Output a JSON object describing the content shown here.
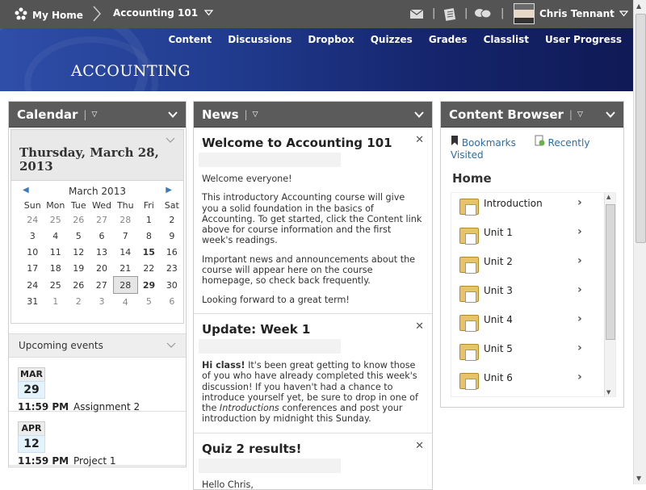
{
  "topbar": {
    "home_label": "My Home",
    "course_label": "Accounting 101",
    "user_name": "Chris Tennant"
  },
  "banner": {
    "course_title": "ACCOUNTING",
    "nav": [
      "Content",
      "Discussions",
      "Dropbox",
      "Quizzes",
      "Grades",
      "Classlist",
      "User Progress"
    ]
  },
  "calendar": {
    "title": "Calendar",
    "selected_date": "Thursday, March 28, 2013",
    "month_label": "March 2013",
    "weekdays": [
      "Sun",
      "Mon",
      "Tue",
      "Wed",
      "Thu",
      "Fri",
      "Sat"
    ],
    "weeks": [
      [
        "24",
        "25",
        "26",
        "27",
        "28",
        "1",
        "2"
      ],
      [
        "3",
        "4",
        "5",
        "6",
        "7",
        "8",
        "9"
      ],
      [
        "10",
        "11",
        "12",
        "13",
        "14",
        "15",
        "16"
      ],
      [
        "17",
        "18",
        "19",
        "20",
        "21",
        "22",
        "23"
      ],
      [
        "24",
        "25",
        "26",
        "27",
        "28",
        "29",
        "30"
      ],
      [
        "31",
        "1",
        "2",
        "3",
        "4",
        "5",
        "6"
      ]
    ],
    "upcoming_label": "Upcoming events",
    "events": [
      {
        "month": "MAR",
        "day": "29",
        "time": "11:59 PM",
        "title": "Assignment 2"
      },
      {
        "month": "APR",
        "day": "12",
        "time": "11:59 PM",
        "title": "Project 1"
      }
    ]
  },
  "news": {
    "title": "News",
    "items": [
      {
        "title": "Welcome to Accounting 101",
        "paragraphs": [
          "Welcome everyone!",
          "This introductory Accounting course will give you a solid foundation in the basics of Accounting. To get started, click the Content link above for course information and the first week's readings.",
          "Important news and announcements about the course will appear here on the course homepage, so check back frequently.",
          "Looking forward to a great term!"
        ]
      },
      {
        "title": "Update: Week 1",
        "bold_intro": "Hi class!",
        "body_before": " It's been great getting to know those of you who have already completed this week's discussion! If you haven't had a chance to introduce yourself yet, be sure to drop in one of the ",
        "italic": "Introductions",
        "body_after": " conferences and post your introduction by midnight this Sunday."
      },
      {
        "title": "Quiz 2 results!",
        "paragraphs": [
          "Hello Chris,"
        ]
      }
    ]
  },
  "content_browser": {
    "title": "Content Browser",
    "bookmarks_label": "Bookmarks",
    "recent_label": "Recently Visited",
    "home_title": "Home",
    "items": [
      "Introduction",
      "Unit 1",
      "Unit 2",
      "Unit 3",
      "Unit 4",
      "Unit 5",
      "Unit 6"
    ]
  }
}
